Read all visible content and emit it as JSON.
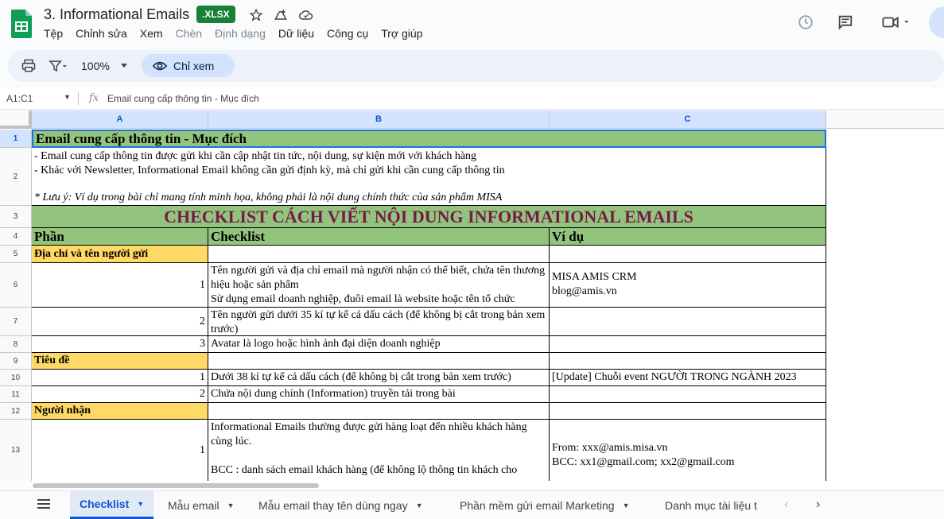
{
  "app": {
    "doc_title": "3. Informational Emails",
    "file_badge": ".XLSX",
    "menu": [
      "Tệp",
      "Chỉnh sửa",
      "Xem",
      "Chèn",
      "Định dạng",
      "Dữ liệu",
      "Công cụ",
      "Trợ giúp"
    ],
    "disabled_menu": [
      "Chèn",
      "Định dạng"
    ]
  },
  "toolbar": {
    "zoom": "100%",
    "view_only_label": "Chỉ xem"
  },
  "formula_bar": {
    "name_box": "A1:C1",
    "fx": "fx",
    "content": "Email cung cấp thông tin - Mục đích"
  },
  "columns": [
    "A",
    "B",
    "C"
  ],
  "rows": {
    "r1": {
      "num": "1",
      "a": "Email cung cấp thông tin - Mục đích"
    },
    "r2": {
      "num": "2",
      "line1": "- Email cung cấp thông tin được gửi khi cần cập nhật tin tức, nội dung, sự kiện mới với khách hàng",
      "line2": "- Khác với Newsletter, Informational Email không cần gửi định kỳ, mà chỉ gửi khi cần cung cấp thông tin",
      "note": "* Lưu ý: Ví dụ trong bài chỉ mang tính minh họa, không phải là nội dung chính thức của sản phẩm MISA"
    },
    "r3": {
      "num": "3",
      "title": "CHECKLIST CÁCH VIẾT NỘI DUNG INFORMATIONAL EMAILS"
    },
    "r4": {
      "num": "4",
      "a": "Phần",
      "b": "Checklist",
      "c": "Ví dụ"
    },
    "r5": {
      "num": "5",
      "a": "Địa chỉ và tên người gửi"
    },
    "r6": {
      "num": "6",
      "a": "1",
      "b1": "Tên người gửi và địa chỉ email mà người nhận có thể biết, chứa tên thương hiệu hoặc sản phẩm",
      "b2": "Sử dụng email doanh nghiệp, đuôi email là website hoặc tên tổ chức",
      "c1": "MISA AMIS CRM",
      "c2": "blog@amis.vn"
    },
    "r7": {
      "num": "7",
      "a": "2",
      "b": "Tên người gửi dưới 35 kí tự kể cả dấu cách (để không bị cắt trong bản xem trước)"
    },
    "r8": {
      "num": "8",
      "a": "3",
      "b": "Avatar là logo hoặc hình ảnh đại diện doanh nghiệp"
    },
    "r9": {
      "num": "9",
      "a": "Tiêu đề"
    },
    "r10": {
      "num": "10",
      "a": "1",
      "b": "Dưới 38 kí tự kể cả dấu cách (để không bị cắt trong bản xem trước)",
      "c": "[Update] Chuỗi event NGƯỜI TRONG NGÀNH 2023"
    },
    "r11": {
      "num": "11",
      "a": "2",
      "b": "Chứa nội dung chính (Information) truyền tải trong bài"
    },
    "r12": {
      "num": "12",
      "a": "Người nhận"
    },
    "r13": {
      "num": "13",
      "a": "1",
      "b1": "Informational Emails thường được gửi hàng loạt đến nhiều khách hàng cùng lúc.",
      "b2": "BCC : danh sách email khách hàng (để không lộ thông tin khách cho",
      "c1": "From: xxx@amis.misa.vn",
      "c2": "BCC: xx1@gmail.com; xx2@gmail.com"
    }
  },
  "sheets": [
    "Checklist",
    "Mẫu email",
    "Mẫu email thay tên dùng ngay",
    "Phần mềm gửi email Marketing",
    "Danh mục tài liệu t"
  ],
  "active_sheet": "Checklist",
  "colors": {
    "header_green": "#93c47d",
    "section_yellow": "#ffd966",
    "title_text": "#741b47",
    "sheets_green": "#0f9d58"
  }
}
